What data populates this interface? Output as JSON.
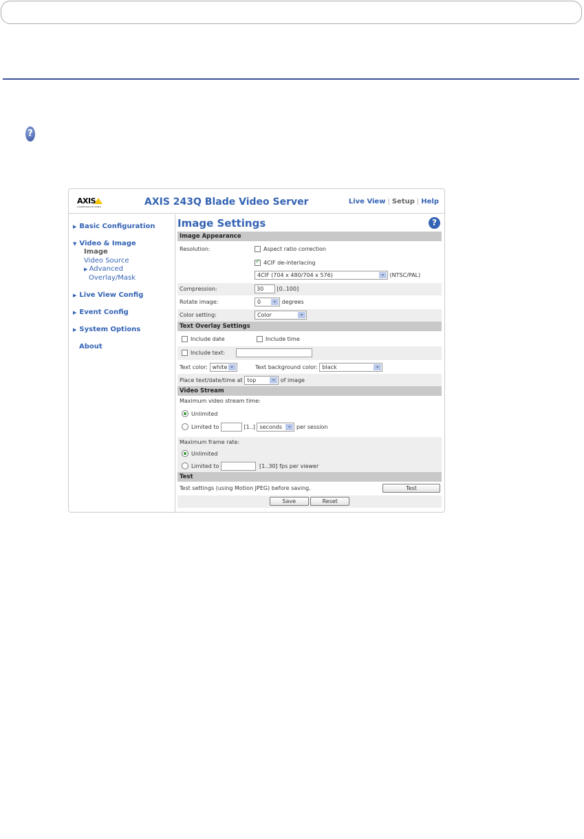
{
  "header": {
    "logo": "AXIS",
    "logo_sub": "COMMUNICATIONS",
    "title": "AXIS 243Q Blade Video Server",
    "links": [
      "Live View",
      "Setup",
      "Help"
    ]
  },
  "sidebar": {
    "items": [
      "Basic Configuration",
      "Video & Image",
      "Live View Config",
      "Event Config",
      "System Options",
      "About"
    ],
    "sub": [
      "Image",
      "Video Source",
      "Advanced",
      "Overlay/Mask"
    ]
  },
  "main": {
    "title": "Image Settings",
    "appearance": {
      "header": "Image Appearance",
      "resolution_label": "Resolution:",
      "aspect": "Aspect ratio correction",
      "deinterlace": "4CIF de-interlacing",
      "resolution_value": "4CIF (704 x 480/704 x 576)",
      "ntsc": "(NTSC/PAL)",
      "compression_label": "Compression:",
      "compression_value": "30",
      "compression_range": "[0..100]",
      "rotate_label": "Rotate image:",
      "rotate_value": "0",
      "degrees": "degrees",
      "color_label": "Color setting:",
      "color_value": "Color"
    },
    "overlay": {
      "header": "Text Overlay Settings",
      "include_date": "Include date",
      "include_time": "Include time",
      "include_text": "Include text:",
      "text_value": "",
      "text_color_label": "Text color:",
      "text_color": "white",
      "bg_label": "Text background color:",
      "bg_color": "black",
      "place_label": "Place text/date/time at",
      "place_value": "top",
      "of_image": "of image"
    },
    "stream": {
      "header": "Video Stream",
      "max_time": "Maximum video stream time:",
      "unlimited": "Unlimited",
      "limited": "Limited to",
      "time_range": "[1..]",
      "time_unit": "seconds",
      "per_session": "per session",
      "max_fps": "Maximum frame rate:",
      "fps_range": "[1..30] fps per viewer"
    },
    "test": {
      "header": "Test",
      "desc": "Test settings (using Motion JPEG) before saving.",
      "test_btn": "Test",
      "save_btn": "Save",
      "reset_btn": "Reset"
    }
  }
}
